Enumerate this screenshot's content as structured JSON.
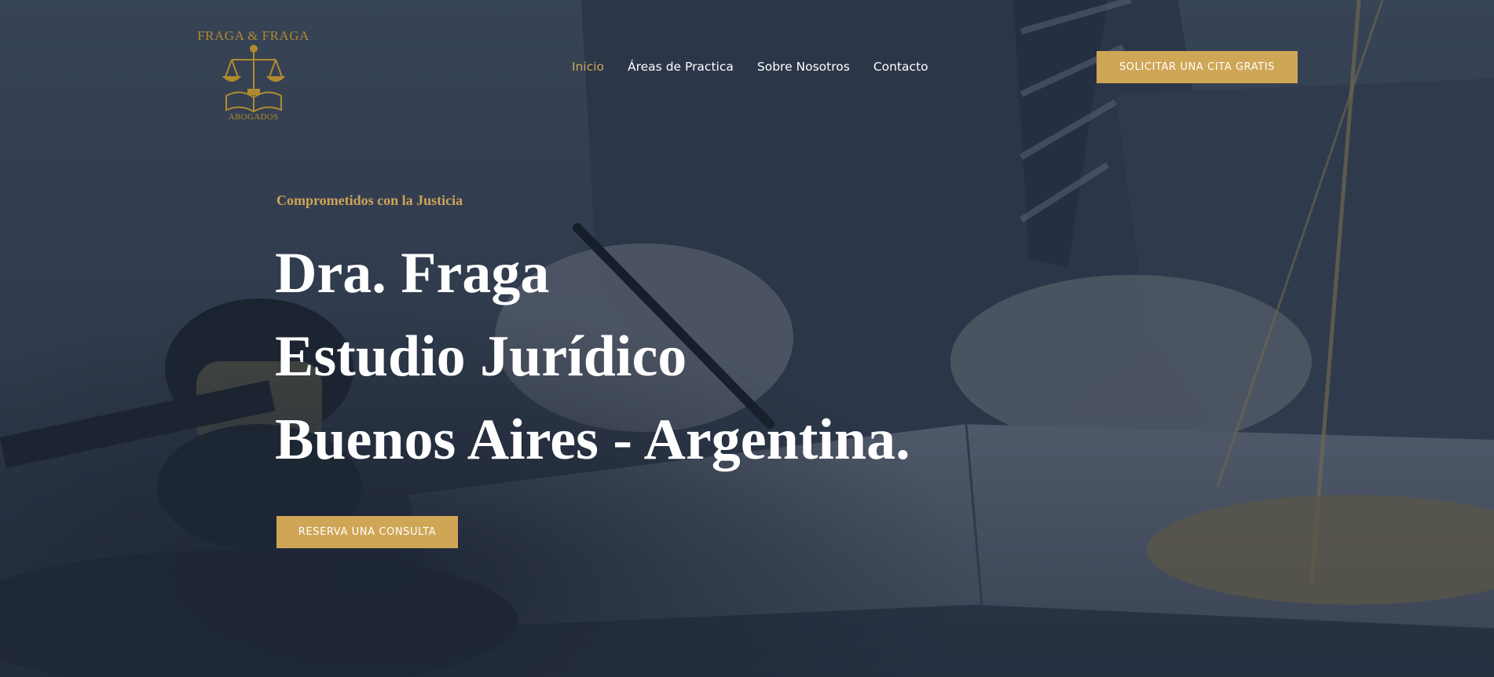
{
  "colors": {
    "accent": "#cfa656",
    "overlay": "#2f3a4d",
    "text": "#ffffff"
  },
  "logo": {
    "top_text": "FRAGA & FRAGA",
    "bottom_text": "ABOGADOS",
    "icon": "scales-of-justice-book-icon"
  },
  "nav": {
    "items": [
      {
        "label": "Inicio",
        "active": true
      },
      {
        "label": "Áreas de Practica",
        "active": false
      },
      {
        "label": "Sobre Nosotros",
        "active": false
      },
      {
        "label": "Contacto",
        "active": false
      }
    ]
  },
  "header_cta": {
    "label": "SOLICITAR UNA CITA GRATIS"
  },
  "hero": {
    "tagline": "Comprometidos con la Justicia",
    "headline_lines": [
      "Dra. Fraga",
      "Estudio Jurídico",
      "Buenos Aires - Argentina."
    ],
    "cta_label": "RESERVA UNA CONSULTA"
  }
}
